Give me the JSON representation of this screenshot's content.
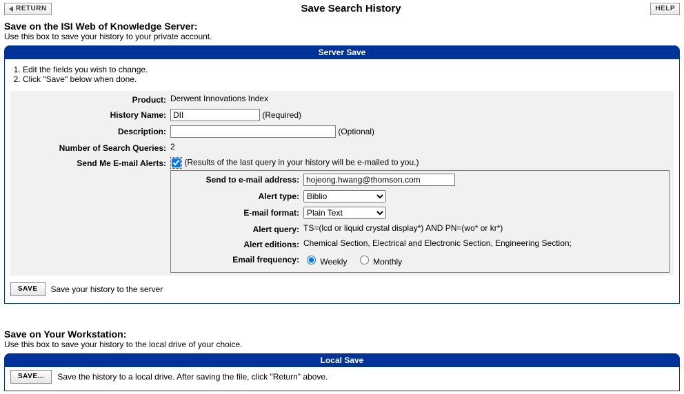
{
  "top": {
    "return": "RETURN",
    "help": "HELP",
    "title": "Save Search History"
  },
  "server": {
    "heading": "Save on the ISI Web of Knowledge Server:",
    "sub": "Use this box to save your history to your private account.",
    "banner": "Server Save",
    "instr1": "Edit the fields you wish to change.",
    "instr2": "Click \"Save\" below when done.",
    "labels": {
      "product": "Product:",
      "hname": "History Name:",
      "desc": "Description:",
      "num": "Number of Search Queries:",
      "alerts": "Send Me E-mail Alerts:"
    },
    "product": "Derwent Innovations Index",
    "hname_value": "DII",
    "hname_suffix": "(Required)",
    "desc_suffix": "(Optional)",
    "num_value": "2",
    "alerts_checked": true,
    "alerts_note": "(Results of the last query in your history will be e-mailed to you.)",
    "sublabels": {
      "sendto": "Send to e-mail address:",
      "atype": "Alert type:",
      "eformat": "E-mail format:",
      "aquery": "Alert query:",
      "aed": "Alert editions:",
      "efreq": "Email frequency:"
    },
    "email_value": "hojeong.hwang@thomson.com",
    "alert_type_value": "Biblio",
    "email_format_value": "Plain Text",
    "alert_query": "TS=(lcd or liquid crystal display*) AND PN=(wo* or kr*)",
    "alert_editions": "Chemical Section, Electrical and Electronic Section, Engineering Section;",
    "freq_weekly": "Weekly",
    "freq_monthly": "Monthly",
    "save_btn": "SAVE",
    "save_note": "Save your history to the server"
  },
  "local": {
    "heading": "Save on Your Workstation:",
    "sub": "Use this box to save your history to the local drive of your choice.",
    "banner": "Local Save",
    "save_btn": "SAVE...",
    "save_note": "Save the history to a local drive. After saving the file, click \"Return\" above."
  }
}
